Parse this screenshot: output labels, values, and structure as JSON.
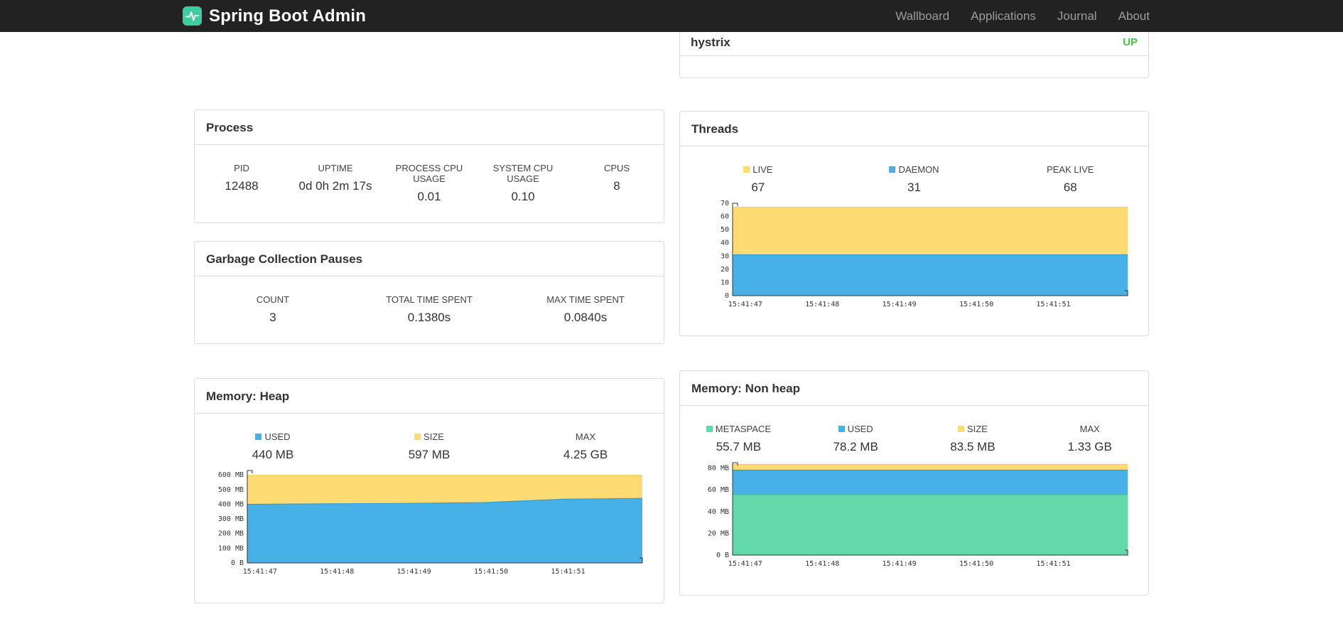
{
  "navbar": {
    "brand": "Spring Boot Admin",
    "brand_color": "#3fcda0",
    "items": [
      {
        "label": "Wallboard"
      },
      {
        "label": "Applications"
      },
      {
        "label": "Journal"
      },
      {
        "label": "About"
      }
    ]
  },
  "application": {
    "name": "hystrix",
    "status": "UP",
    "status_color": "#44c544"
  },
  "process": {
    "title": "Process",
    "columns": [
      {
        "label": "PID",
        "value": "12488"
      },
      {
        "label": "UPTIME",
        "value": "0d 0h 2m 17s"
      },
      {
        "label": "PROCESS CPU USAGE",
        "value": "0.01"
      },
      {
        "label": "SYSTEM CPU USAGE",
        "value": "0.10"
      },
      {
        "label": "CPUS",
        "value": "8"
      }
    ]
  },
  "gc": {
    "title": "Garbage Collection Pauses",
    "columns": [
      {
        "label": "COUNT",
        "value": "3"
      },
      {
        "label": "TOTAL TIME SPENT",
        "value": "0.1380s"
      },
      {
        "label": "MAX TIME SPENT",
        "value": "0.0840s"
      }
    ]
  },
  "threads": {
    "title": "Threads",
    "legend": [
      {
        "label": "LIVE",
        "value": "67",
        "color": "#FFDC73"
      },
      {
        "label": "DAEMON",
        "value": "31",
        "color": "#47B0E6"
      },
      {
        "label": "PEAK LIVE",
        "value": "68",
        "color": null
      }
    ]
  },
  "heap": {
    "title": "Memory: Heap",
    "legend": [
      {
        "label": "USED",
        "value": "440 MB",
        "color": "#47B0E6"
      },
      {
        "label": "SIZE",
        "value": "597 MB",
        "color": "#FFDC73"
      },
      {
        "label": "MAX",
        "value": "4.25 GB",
        "color": null
      }
    ]
  },
  "nonheap": {
    "title": "Memory: Non heap",
    "legend": [
      {
        "label": "METASPACE",
        "value": "55.7 MB",
        "color": "#63D8A8"
      },
      {
        "label": "USED",
        "value": "78.2 MB",
        "color": "#47B0E6"
      },
      {
        "label": "SIZE",
        "value": "83.5 MB",
        "color": "#FFDC73"
      },
      {
        "label": "MAX",
        "value": "1.33 GB",
        "color": null
      }
    ]
  },
  "chart_data": [
    {
      "id": "threads-chart",
      "type": "area",
      "title": "Threads",
      "x": [
        "15:41:47",
        "15:41:48",
        "15:41:49",
        "15:41:50",
        "15:41:51"
      ],
      "ylim": [
        0,
        70
      ],
      "yticks": [
        {
          "value": 70,
          "label": "70"
        },
        {
          "value": 60,
          "label": "60"
        },
        {
          "value": 50,
          "label": "50"
        },
        {
          "value": 40,
          "label": "40"
        },
        {
          "value": 30,
          "label": "30"
        },
        {
          "value": 20,
          "label": "20"
        },
        {
          "value": 10,
          "label": "10"
        },
        {
          "value": 0,
          "label": "0"
        }
      ],
      "series": [
        {
          "name": "LIVE",
          "color": "#FFDC73",
          "stroke": "#f3c74a",
          "values": [
            67,
            67,
            67,
            67,
            67,
            67
          ]
        },
        {
          "name": "DAEMON",
          "color": "#47B0E6",
          "stroke": "#2d96d4",
          "values": [
            31,
            31,
            31,
            31,
            31,
            31
          ]
        }
      ]
    },
    {
      "id": "heap-chart",
      "type": "area",
      "title": "Memory: Heap",
      "x": [
        "15:41:47",
        "15:41:48",
        "15:41:49",
        "15:41:50",
        "15:41:51"
      ],
      "ylim": [
        0,
        630
      ],
      "yticks": [
        {
          "value": 600,
          "label": "600 MB"
        },
        {
          "value": 500,
          "label": "500 MB"
        },
        {
          "value": 400,
          "label": "400 MB"
        },
        {
          "value": 300,
          "label": "300 MB"
        },
        {
          "value": 200,
          "label": "200 MB"
        },
        {
          "value": 100,
          "label": "100 MB"
        },
        {
          "value": 0,
          "label": "0 B"
        }
      ],
      "series": [
        {
          "name": "SIZE",
          "color": "#FFDC73",
          "stroke": "#f3c74a",
          "values": [
            597,
            597,
            597,
            597,
            597,
            597
          ]
        },
        {
          "name": "USED",
          "color": "#47B0E6",
          "stroke": "#2d96d4",
          "values": [
            400,
            403,
            406,
            412,
            435,
            440
          ]
        }
      ]
    },
    {
      "id": "nonheap-chart",
      "type": "area",
      "title": "Memory: Non heap",
      "x": [
        "15:41:47",
        "15:41:48",
        "15:41:49",
        "15:41:50",
        "15:41:51"
      ],
      "ylim": [
        0,
        85
      ],
      "yticks": [
        {
          "value": 80,
          "label": "80 MB"
        },
        {
          "value": 60,
          "label": "60 MB"
        },
        {
          "value": 40,
          "label": "40 MB"
        },
        {
          "value": 20,
          "label": "20 MB"
        },
        {
          "value": 0,
          "label": "0 B"
        }
      ],
      "series": [
        {
          "name": "SIZE",
          "color": "#FFDC73",
          "stroke": "#f3c74a",
          "values": [
            83.5,
            83.5,
            83.5,
            83.5,
            83.5,
            83.5
          ]
        },
        {
          "name": "USED",
          "color": "#47B0E6",
          "stroke": "#2d96d4",
          "values": [
            78.2,
            78.2,
            78.2,
            78.2,
            78.2,
            78.2
          ]
        },
        {
          "name": "METASPACE",
          "color": "#63D8A8",
          "stroke": "#3fbd8c",
          "values": [
            55.7,
            55.7,
            55.7,
            55.7,
            55.7,
            55.7
          ]
        }
      ]
    }
  ]
}
